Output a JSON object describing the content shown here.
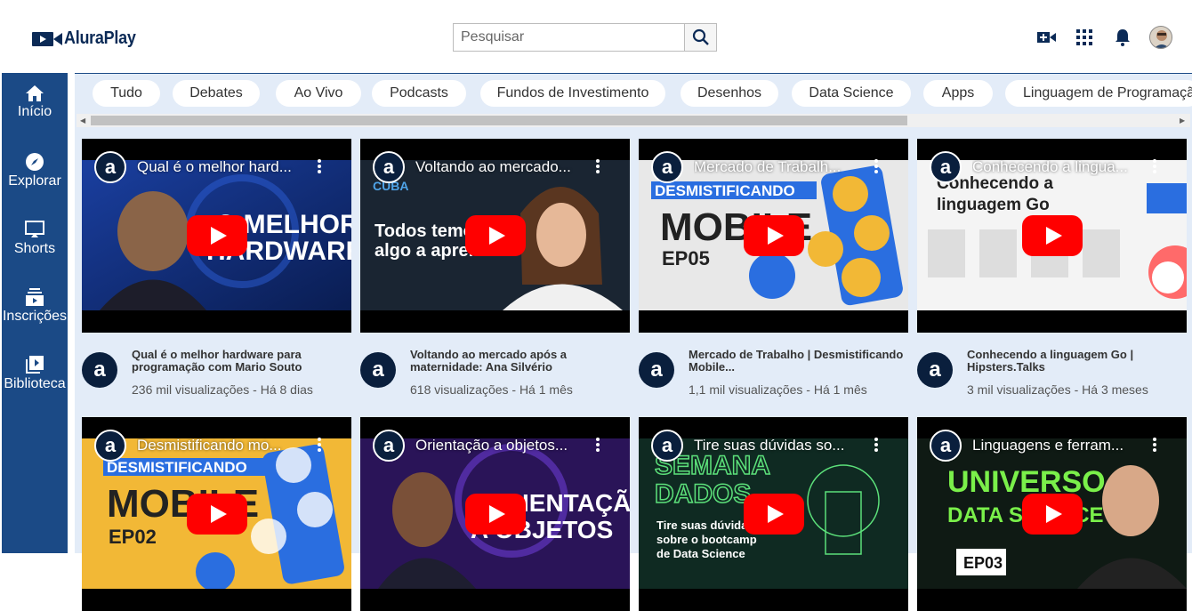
{
  "header": {
    "logo_text": "AluraPlay",
    "search_placeholder": "Pesquisar",
    "icons": [
      "video-camera-add-icon",
      "apps-grid-icon",
      "bell-icon",
      "avatar"
    ]
  },
  "sidebar": {
    "items": [
      {
        "label": "Início",
        "icon": "home-icon"
      },
      {
        "label": "Explorar",
        "icon": "compass-icon"
      },
      {
        "label": "Shorts",
        "icon": "shorts-icon"
      },
      {
        "label": "Inscrições",
        "icon": "subscriptions-icon"
      },
      {
        "label": "Biblioteca",
        "icon": "library-icon"
      }
    ]
  },
  "chips": [
    "Tudo",
    "Debates",
    "Ao Vivo",
    "Podcasts",
    "Fundos de Investimento",
    "Desenhos",
    "Data Science",
    "Apps",
    "Linguagem de Programação"
  ],
  "videos": [
    {
      "overlay_title": "Qual é o melhor hard...",
      "title": "Qual é o melhor hardware para programação com Mario Souto",
      "stats": "236 mil visualizações - Há 8 dias",
      "thumb_text": "O MELHOR HARDWARE"
    },
    {
      "overlay_title": "Voltando ao mercado...",
      "title": "Voltando ao mercado após a maternidade: Ana Silvério",
      "stats": "618 visualizações - Há 1 mês",
      "thumb_text": "Todos temos algo a aprender"
    },
    {
      "overlay_title": "Mercado de Trabalh...",
      "title": "Mercado de Trabalho | Desmistificando Mobile...",
      "stats": "1,1 mil visualizações - Há 1 mês",
      "thumb_text": "DESMISTIFICANDO MOBILE EP05"
    },
    {
      "overlay_title": "Conhecendo a lingua...",
      "title": "Conhecendo a linguagem Go | Hipsters.Talks",
      "stats": "3 mil visualizações - Há 3 meses",
      "thumb_text": "Conhecendo a linguagem Go"
    },
    {
      "overlay_title": "Desmistificando mo...",
      "title": "",
      "stats": "",
      "thumb_text": "DESMISTIFICANDO MOBILE EP02"
    },
    {
      "overlay_title": "Orientação a objetos...",
      "title": "",
      "stats": "",
      "thumb_text": "ORIENTAÇÃO A OBJETOS"
    },
    {
      "overlay_title": "Tire suas dúvidas so...",
      "title": "",
      "stats": "",
      "thumb_text": "SEMANA DADOS"
    },
    {
      "overlay_title": "Linguagens e ferram...",
      "title": "",
      "stats": "",
      "thumb_text": "UNIVERSO DATA SCIENCE EP03"
    }
  ],
  "colors": {
    "sidebar": "#1b4a86",
    "content_bg": "#e3ecf8",
    "play_red": "#ff0000",
    "brand_dark": "#0a1f3d"
  }
}
